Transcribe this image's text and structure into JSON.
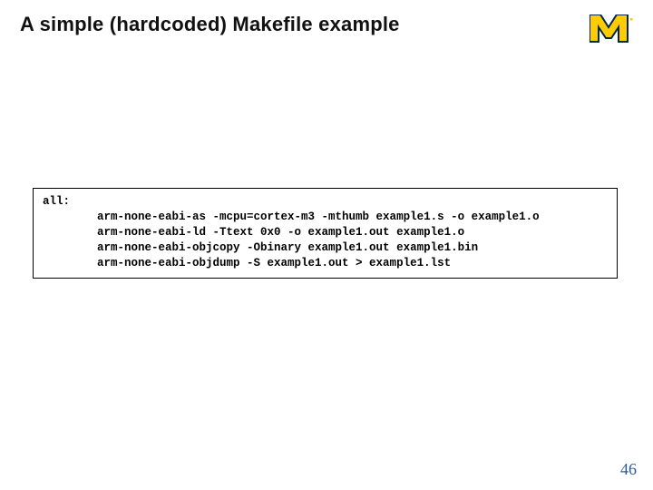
{
  "title": "A simple (hardcoded) Makefile example",
  "logo_color_maize": "#ffcb05",
  "logo_color_blue": "#00274c",
  "code": "all:\n        arm-none-eabi-as -mcpu=cortex-m3 -mthumb example1.s -o example1.o\n        arm-none-eabi-ld -Ttext 0x0 -o example1.out example1.o\n        arm-none-eabi-objcopy -Obinary example1.out example1.bin\n        arm-none-eabi-objdump -S example1.out > example1.lst",
  "page_number": "46"
}
